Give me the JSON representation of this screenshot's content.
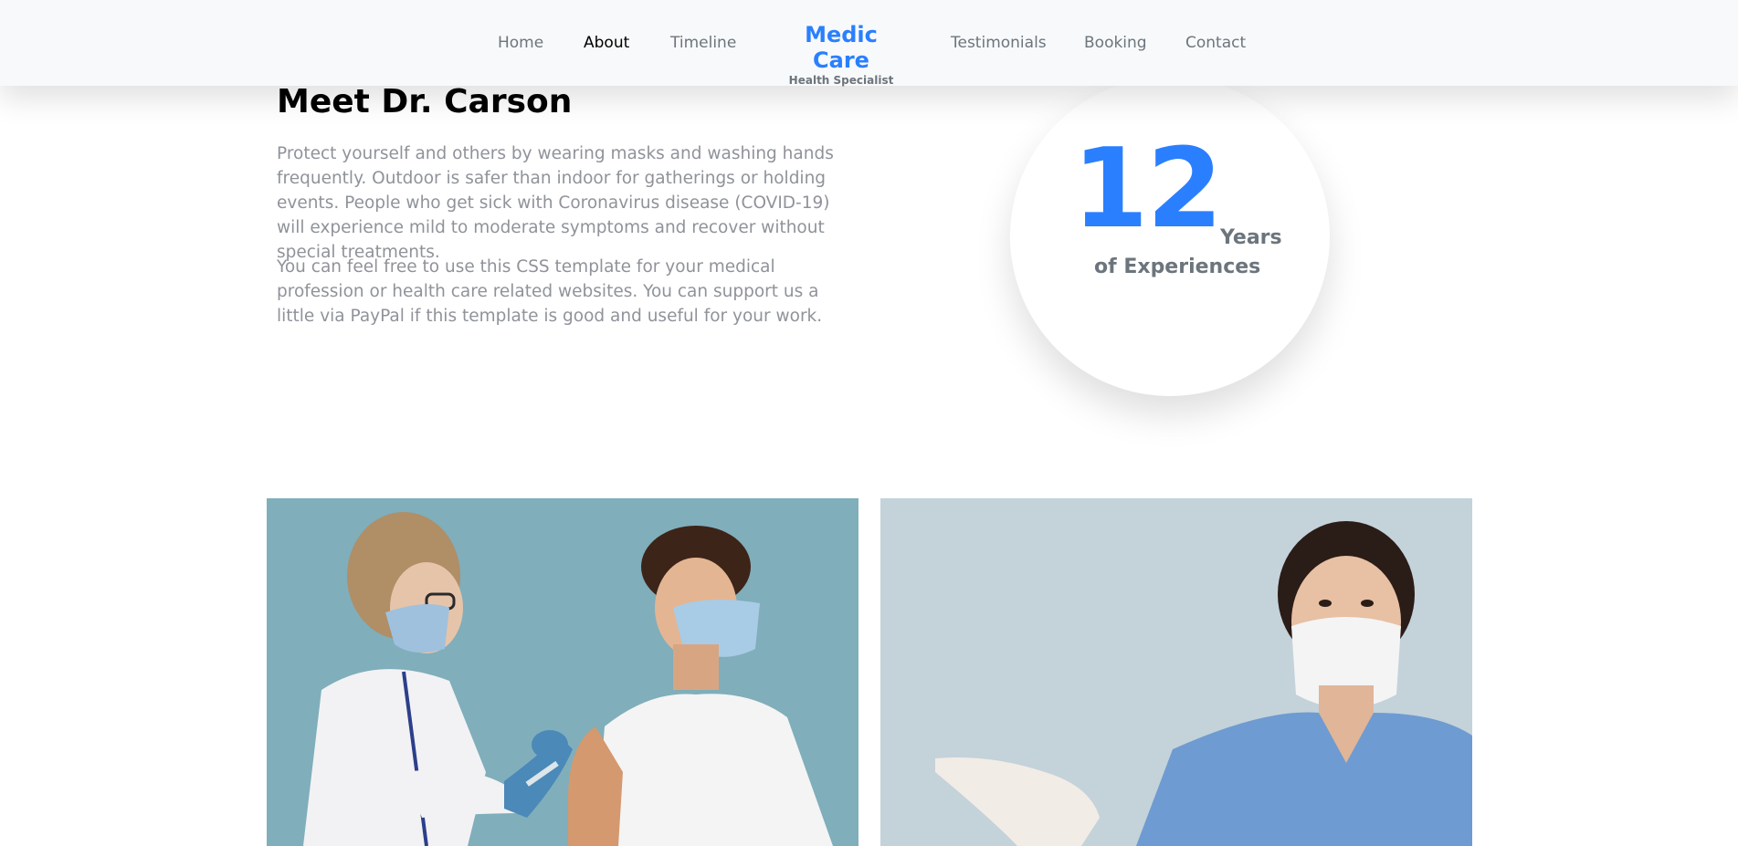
{
  "nav": {
    "items": [
      {
        "label": "Home",
        "active": false
      },
      {
        "label": "About",
        "active": true
      },
      {
        "label": "Timeline",
        "active": false
      }
    ],
    "items_right": [
      {
        "label": "Testimonials",
        "active": false
      },
      {
        "label": "Booking",
        "active": false
      },
      {
        "label": "Contact",
        "active": false
      }
    ],
    "brand": {
      "title": "Medic Care",
      "subtitle": "Health Specialist"
    }
  },
  "about": {
    "title": "Meet Dr. Carson",
    "paragraphs": [
      "Protect yourself and others by wearing masks and washing hands frequently. Outdoor is safer than indoor for gatherings or holding events. People who get sick with Coronavirus disease (COVID-19) will experience mild to moderate symptoms and recover without special treatments.",
      "You can feel free to use this CSS template for your medical profession or health care related websites. You can support us a little via PayPal if this template is good and useful for your work."
    ]
  },
  "experience": {
    "number": "12",
    "unit": "Years",
    "label": "of Experiences"
  },
  "photos": [
    {
      "name": "doctor-vaccinating-patient-photo"
    },
    {
      "name": "nurse-with-mask-photo"
    }
  ],
  "colors": {
    "accent": "#2a7fff",
    "muted_text": "#6c757d",
    "body_text": "#8f9399",
    "navbar_bg": "#f8f9fa"
  }
}
